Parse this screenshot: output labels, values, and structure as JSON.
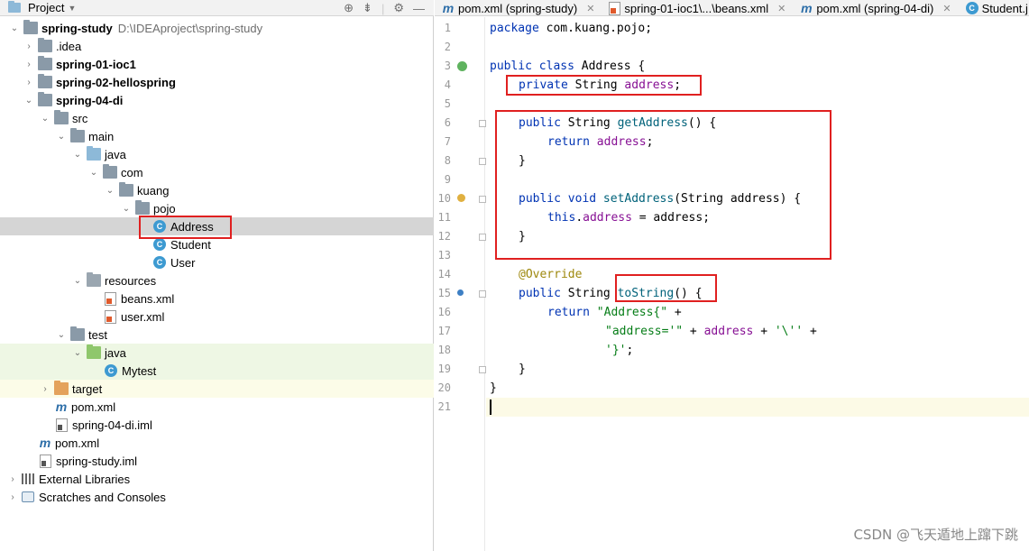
{
  "project_panel": {
    "title": "Project",
    "tree": [
      {
        "label": "spring-study",
        "extra": "D:\\IDEAproject\\spring-study",
        "bold": true
      },
      {
        "label": ".idea"
      },
      {
        "label": "spring-01-ioc1",
        "bold": true
      },
      {
        "label": "spring-02-hellospring",
        "bold": true
      },
      {
        "label": "spring-04-di",
        "bold": true
      },
      {
        "label": "src"
      },
      {
        "label": "main"
      },
      {
        "label": "java"
      },
      {
        "label": "com"
      },
      {
        "label": "kuang"
      },
      {
        "label": "pojo"
      },
      {
        "label": "Address",
        "class_badge": "C"
      },
      {
        "label": "Student",
        "class_badge": "C"
      },
      {
        "label": "User",
        "class_badge": "C"
      },
      {
        "label": "resources"
      },
      {
        "label": "beans.xml"
      },
      {
        "label": "user.xml"
      },
      {
        "label": "test"
      },
      {
        "label": "java"
      },
      {
        "label": "Mytest",
        "class_badge": "C"
      },
      {
        "label": "target"
      },
      {
        "label": "pom.xml",
        "mvn_badge": "m"
      },
      {
        "label": "spring-04-di.iml"
      },
      {
        "label": "pom.xml",
        "mvn_badge": "m"
      },
      {
        "label": "spring-study.iml"
      },
      {
        "label": "External Libraries"
      },
      {
        "label": "Scratches and Consoles"
      }
    ]
  },
  "tabs": [
    {
      "label": "pom.xml (spring-study)",
      "icon": "m"
    },
    {
      "label": "spring-01-ioc1\\...\\beans.xml"
    },
    {
      "label": "pom.xml (spring-04-di)",
      "icon": "m"
    },
    {
      "label": "Student.j",
      "icon": "C"
    }
  ],
  "code": {
    "line_numbers": [
      "1",
      "2",
      "3",
      "4",
      "5",
      "6",
      "7",
      "8",
      "9",
      "10",
      "11",
      "12",
      "13",
      "14",
      "15",
      "16",
      "17",
      "18",
      "19",
      "20",
      "21"
    ],
    "lines": {
      "l1": {
        "a": "package ",
        "b": "com.kuang.pojo;"
      },
      "l3": {
        "a": "public class ",
        "b": "Address {"
      },
      "l4": {
        "a": "private ",
        "b": "String ",
        "c": "address",
        "d": ";"
      },
      "l6": {
        "a": "public ",
        "b": "String ",
        "c": "getAddress",
        "d": "() {"
      },
      "l7": {
        "a": "return ",
        "b": "address",
        "c": ";"
      },
      "l8": {
        "a": "}"
      },
      "l10": {
        "a": "public void ",
        "b": "setAddress",
        "c": "(String address) {"
      },
      "l11": {
        "a": "this",
        "b": ".",
        "c": "address",
        "d": " = address;"
      },
      "l12": {
        "a": "}"
      },
      "l14": {
        "a": "@Override"
      },
      "l15": {
        "a": "public ",
        "b": "String ",
        "c": "toString",
        "d": "() {"
      },
      "l16": {
        "a": "return ",
        "b": "\"Address{\"",
        "c": " +"
      },
      "l17": {
        "a": "\"address='\"",
        "b": " + ",
        "c": "address",
        "d": " + ",
        "e": "'\\''",
        "f": " +"
      },
      "l18": {
        "a": "'}'",
        "b": ";"
      },
      "l19": {
        "a": "}"
      },
      "l20": {
        "a": "}"
      }
    }
  },
  "colors": {
    "keyword": "#0033b3",
    "field": "#871094",
    "string": "#067d17",
    "annotation": "#9e880d",
    "highlight_box": "#e02020"
  },
  "watermark": "CSDN @飞天遁地上蹿下跳"
}
